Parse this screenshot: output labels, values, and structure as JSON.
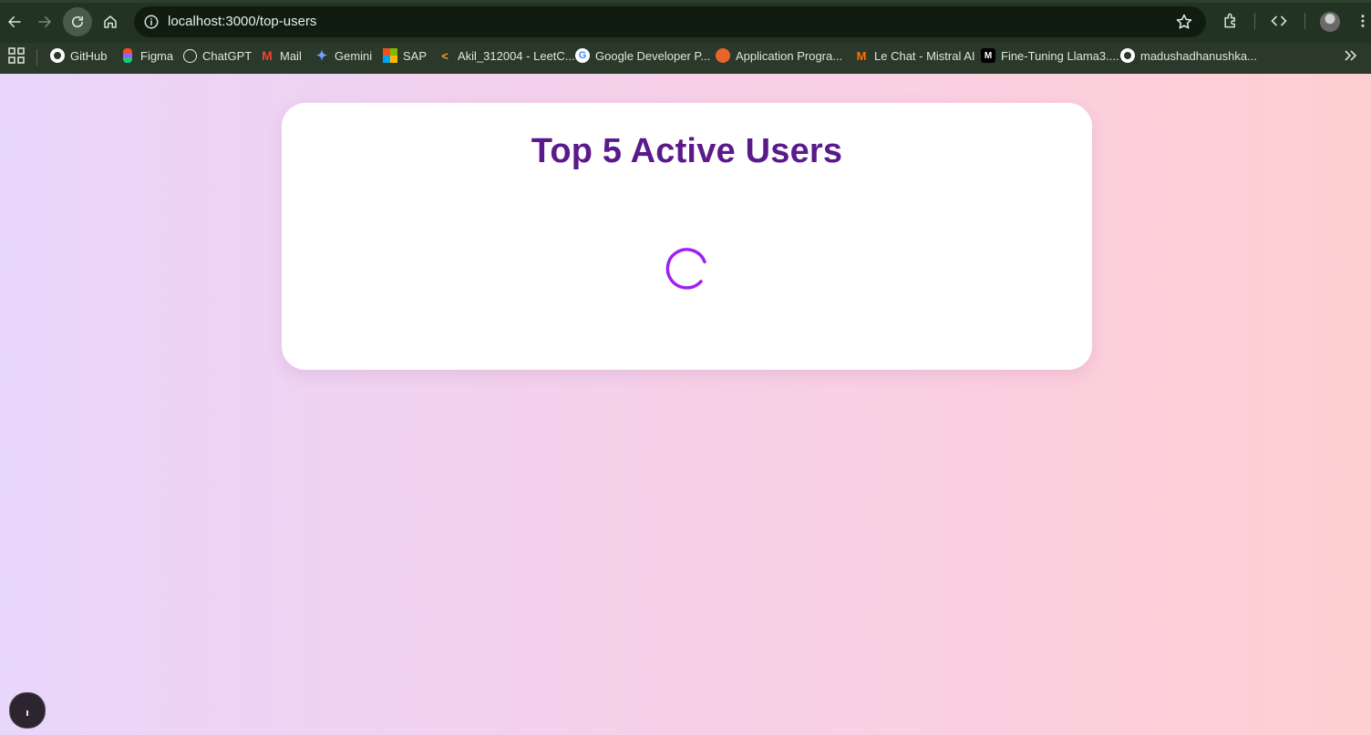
{
  "browser": {
    "url": "localhost:3000/top-users",
    "bookmarks": [
      {
        "label": "GitHub",
        "icon": "github-icon"
      },
      {
        "label": "Figma",
        "icon": "figma-icon"
      },
      {
        "label": "ChatGPT",
        "icon": "chatgpt-icon"
      },
      {
        "label": "Mail",
        "icon": "gmail-icon"
      },
      {
        "label": "Gemini",
        "icon": "gemini-icon"
      },
      {
        "label": "SAP",
        "icon": "microsoft-icon"
      },
      {
        "label": "Akil_312004 - LeetC...",
        "icon": "leetcode-icon"
      },
      {
        "label": "Google Developer P...",
        "icon": "google-icon"
      },
      {
        "label": "Application Progra...",
        "icon": "app-icon"
      },
      {
        "label": "Le Chat - Mistral AI",
        "icon": "mistral-icon"
      },
      {
        "label": "Fine-Tuning Llama3....",
        "icon": "medium-icon"
      },
      {
        "label": "madushadhanushka...",
        "icon": "github-icon"
      }
    ]
  },
  "page": {
    "title": "Top 5 Active Users",
    "loading": true
  },
  "colors": {
    "title": "#5b1a8c",
    "spinner": "#a020f0",
    "card": "#ffffff"
  }
}
